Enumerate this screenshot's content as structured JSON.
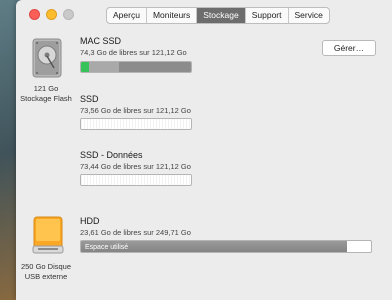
{
  "tabs": [
    {
      "label": "Aperçu",
      "active": false
    },
    {
      "label": "Moniteurs",
      "active": false
    },
    {
      "label": "Stockage",
      "active": true
    },
    {
      "label": "Support",
      "active": false
    },
    {
      "label": "Service",
      "active": false
    }
  ],
  "internal": {
    "icon": "hard-drive-icon",
    "size_label": "121 Go",
    "type_label": "Stockage Flash",
    "manage_label": "Gérer…",
    "volumes": [
      {
        "name": "MAC SSD",
        "info": "74,3 Go de libres sur 121,12 Go"
      },
      {
        "name": "SSD",
        "info": "73,56 Go de libres sur 121,12 Go"
      },
      {
        "name": "SSD - Données",
        "info": "73,44 Go de libres sur 121,12 Go"
      }
    ]
  },
  "external": {
    "icon": "usb-drive-icon",
    "size_label": "250 Go Disque",
    "type_label": "USB externe",
    "volume": {
      "name": "HDD",
      "info": "23,61 Go de libres sur 249,71 Go",
      "bar_label": "Espace utilisé"
    }
  },
  "colors": {
    "apps_segment": "#35c35a",
    "window_close": "#fc5f57",
    "window_minimize": "#fdbc2e"
  }
}
